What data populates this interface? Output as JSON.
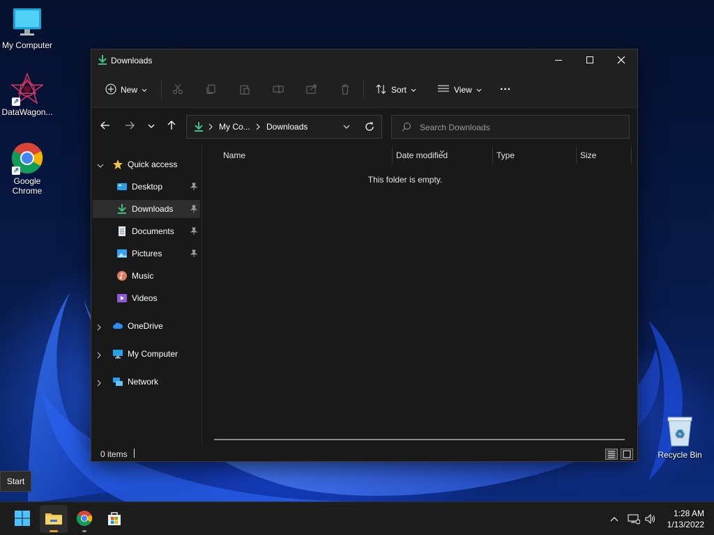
{
  "desktop": {
    "icons": [
      {
        "label": "My Computer"
      },
      {
        "label": "DataWagon..."
      },
      {
        "label": "Google Chrome"
      },
      {
        "label": "Recycle Bin"
      }
    ]
  },
  "window": {
    "title": "Downloads",
    "toolbar": {
      "new_label": "New",
      "sort_label": "Sort",
      "view_label": "View",
      "more_label": "···"
    },
    "address": {
      "crumbs": [
        "My Co...",
        "Downloads"
      ]
    },
    "search": {
      "placeholder": "Search Downloads"
    },
    "sidebar": {
      "quick_access": "Quick access",
      "items": [
        {
          "label": "Desktop",
          "pinned": true
        },
        {
          "label": "Downloads",
          "pinned": true,
          "selected": true
        },
        {
          "label": "Documents",
          "pinned": true
        },
        {
          "label": "Pictures",
          "pinned": true
        },
        {
          "label": "Music",
          "pinned": false
        },
        {
          "label": "Videos",
          "pinned": false
        }
      ],
      "roots": [
        {
          "label": "OneDrive"
        },
        {
          "label": "My Computer"
        },
        {
          "label": "Network"
        }
      ]
    },
    "columns": {
      "name": "Name",
      "date_modified": "Date modified",
      "type": "Type",
      "size": "Size"
    },
    "empty_message": "This folder is empty.",
    "status": {
      "items": "0 items"
    }
  },
  "tooltip": {
    "text": "Start"
  },
  "taskbar": {
    "time": "1:28 AM",
    "date": "1/13/2022"
  },
  "colors": {
    "accent": "#60cdff",
    "download_green": "#3fbf7f",
    "folder_yellow": "#f3c44a"
  }
}
